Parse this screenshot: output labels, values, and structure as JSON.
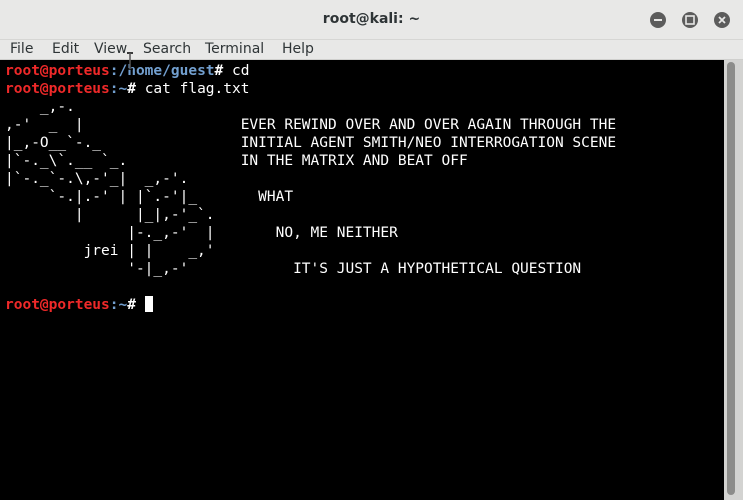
{
  "window": {
    "title": "root@kali: ~"
  },
  "menubar": {
    "items": [
      "File",
      "Edit",
      "View",
      "Search",
      "Terminal",
      "Help"
    ]
  },
  "terminal": {
    "lines": [
      {
        "user": "root@porteus",
        "path": ":/home/guest",
        "symbol": "# ",
        "command": "cd"
      },
      {
        "user": "root@porteus",
        "path": ":~",
        "symbol": "# ",
        "command": "cat flag.txt"
      }
    ],
    "ascii_art": "    _,-.\n,-'  _  |                  EVER REWIND OVER AND OVER AGAIN THROUGH THE\n|_,-O__`-._                INITIAL AGENT SMITH/NEO INTERROGATION SCENE\n|`-._\\`.__ `_.             IN THE MATRIX AND BEAT OFF\n|`-._`-.\\,-'_|  _,-'.\n     `-.|.-' | |`.-'|_       WHAT\n        |      |_|,-'_`.\n              |-._,-'  |       NO, ME NEITHER\n         jrei | |    _,'\n              '-|_,-'            IT'S JUST A HYPOTHETICAL QUESTION",
    "final_prompt": {
      "user": "root@porteus",
      "path": ":~",
      "symbol": "# "
    }
  },
  "colors": {
    "prompt_user": "#ef2929",
    "prompt_path": "#729fcf",
    "background": "#000000",
    "foreground": "#ffffff",
    "titlebar": "#e8e8e7"
  },
  "icons": [
    "minimize-icon",
    "maximize-icon",
    "close-icon",
    "text-cursor-icon"
  ]
}
